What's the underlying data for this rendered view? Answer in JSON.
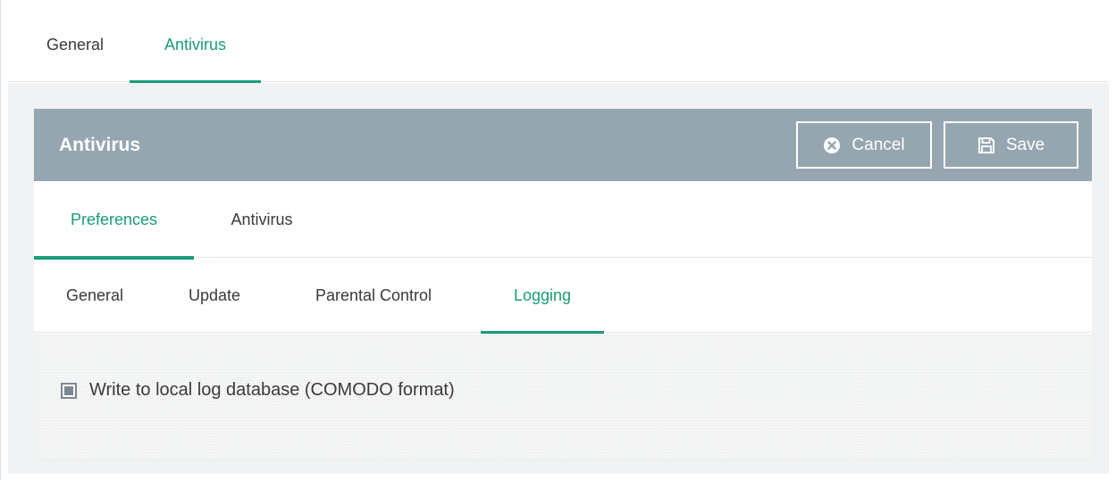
{
  "top_tabs": [
    {
      "label": "General",
      "active": false
    },
    {
      "label": "Antivirus",
      "active": true
    }
  ],
  "panel": {
    "title": "Antivirus",
    "cancel_label": "Cancel",
    "save_label": "Save"
  },
  "sub_tabs": [
    {
      "label": "Preferences",
      "active": true
    },
    {
      "label": "Antivirus",
      "active": false
    }
  ],
  "third_tabs": [
    {
      "label": "General",
      "active": false
    },
    {
      "label": "Update",
      "active": false
    },
    {
      "label": "Parental Control",
      "active": false
    },
    {
      "label": "Logging",
      "active": true
    }
  ],
  "logging": {
    "checkbox_label": "Write to local log database (COMODO format)",
    "checkbox_checked": true
  },
  "colors": {
    "accent": "#1a9c78",
    "header": "#95a6b0"
  },
  "icons": {
    "cancel": "x-circle-icon",
    "save": "floppy-disk-icon"
  }
}
